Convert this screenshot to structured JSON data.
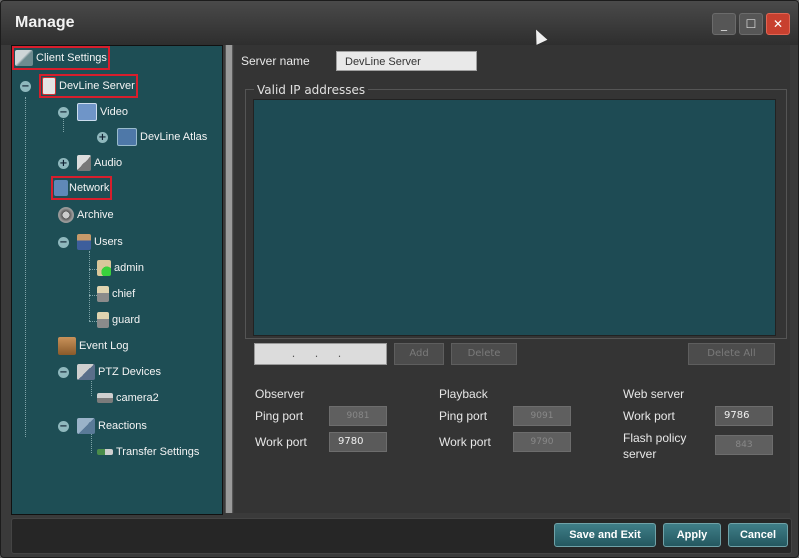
{
  "window": {
    "title": "Manage",
    "controls": {
      "minimize": "_",
      "maximize": "☐",
      "close": "✕"
    }
  },
  "tree": {
    "client_settings": "Client Settings",
    "server": "DevLine Server",
    "video": "Video",
    "camera": "DevLine Atlas",
    "audio": "Audio",
    "network": "Network",
    "archive": "Archive",
    "users": "Users",
    "user_admin": "admin",
    "user_chief": "chief",
    "user_guard": "guard",
    "event_log": "Event Log",
    "ptz_devices": "PTZ Devices",
    "ptz_camera": "camera2",
    "reactions": "Reactions",
    "transfer_settings": "Transfer Settings",
    "expand_plus": "+",
    "collapse_minus": "−"
  },
  "server": {
    "name_label": "Server name",
    "name_value": "DevLine Server"
  },
  "ip": {
    "group_title": "Valid IP addresses",
    "input_value": ". . .",
    "add_button": "Add",
    "delete_button": "Delete",
    "delete_all_button": "Delete All"
  },
  "observer": {
    "title": "Observer",
    "ping_label": "Ping port",
    "ping_value": "9081",
    "work_label": "Work port",
    "work_value": "9780"
  },
  "playback": {
    "title": "Playback",
    "ping_label": "Ping port",
    "ping_value": "9091",
    "work_label": "Work port",
    "work_value": "9790"
  },
  "web": {
    "title": "Web server",
    "work_label": "Work port",
    "work_value": "9786",
    "flash_label_1": "Flash policy",
    "flash_label_2": "server",
    "flash_value": "843"
  },
  "buttons": {
    "save_exit": "Save and Exit",
    "apply": "Apply",
    "cancel": "Cancel"
  },
  "colors": {
    "accent": "#2f6f78",
    "highlight": "#d81e2c",
    "tree_bg": "#1e4e55"
  }
}
